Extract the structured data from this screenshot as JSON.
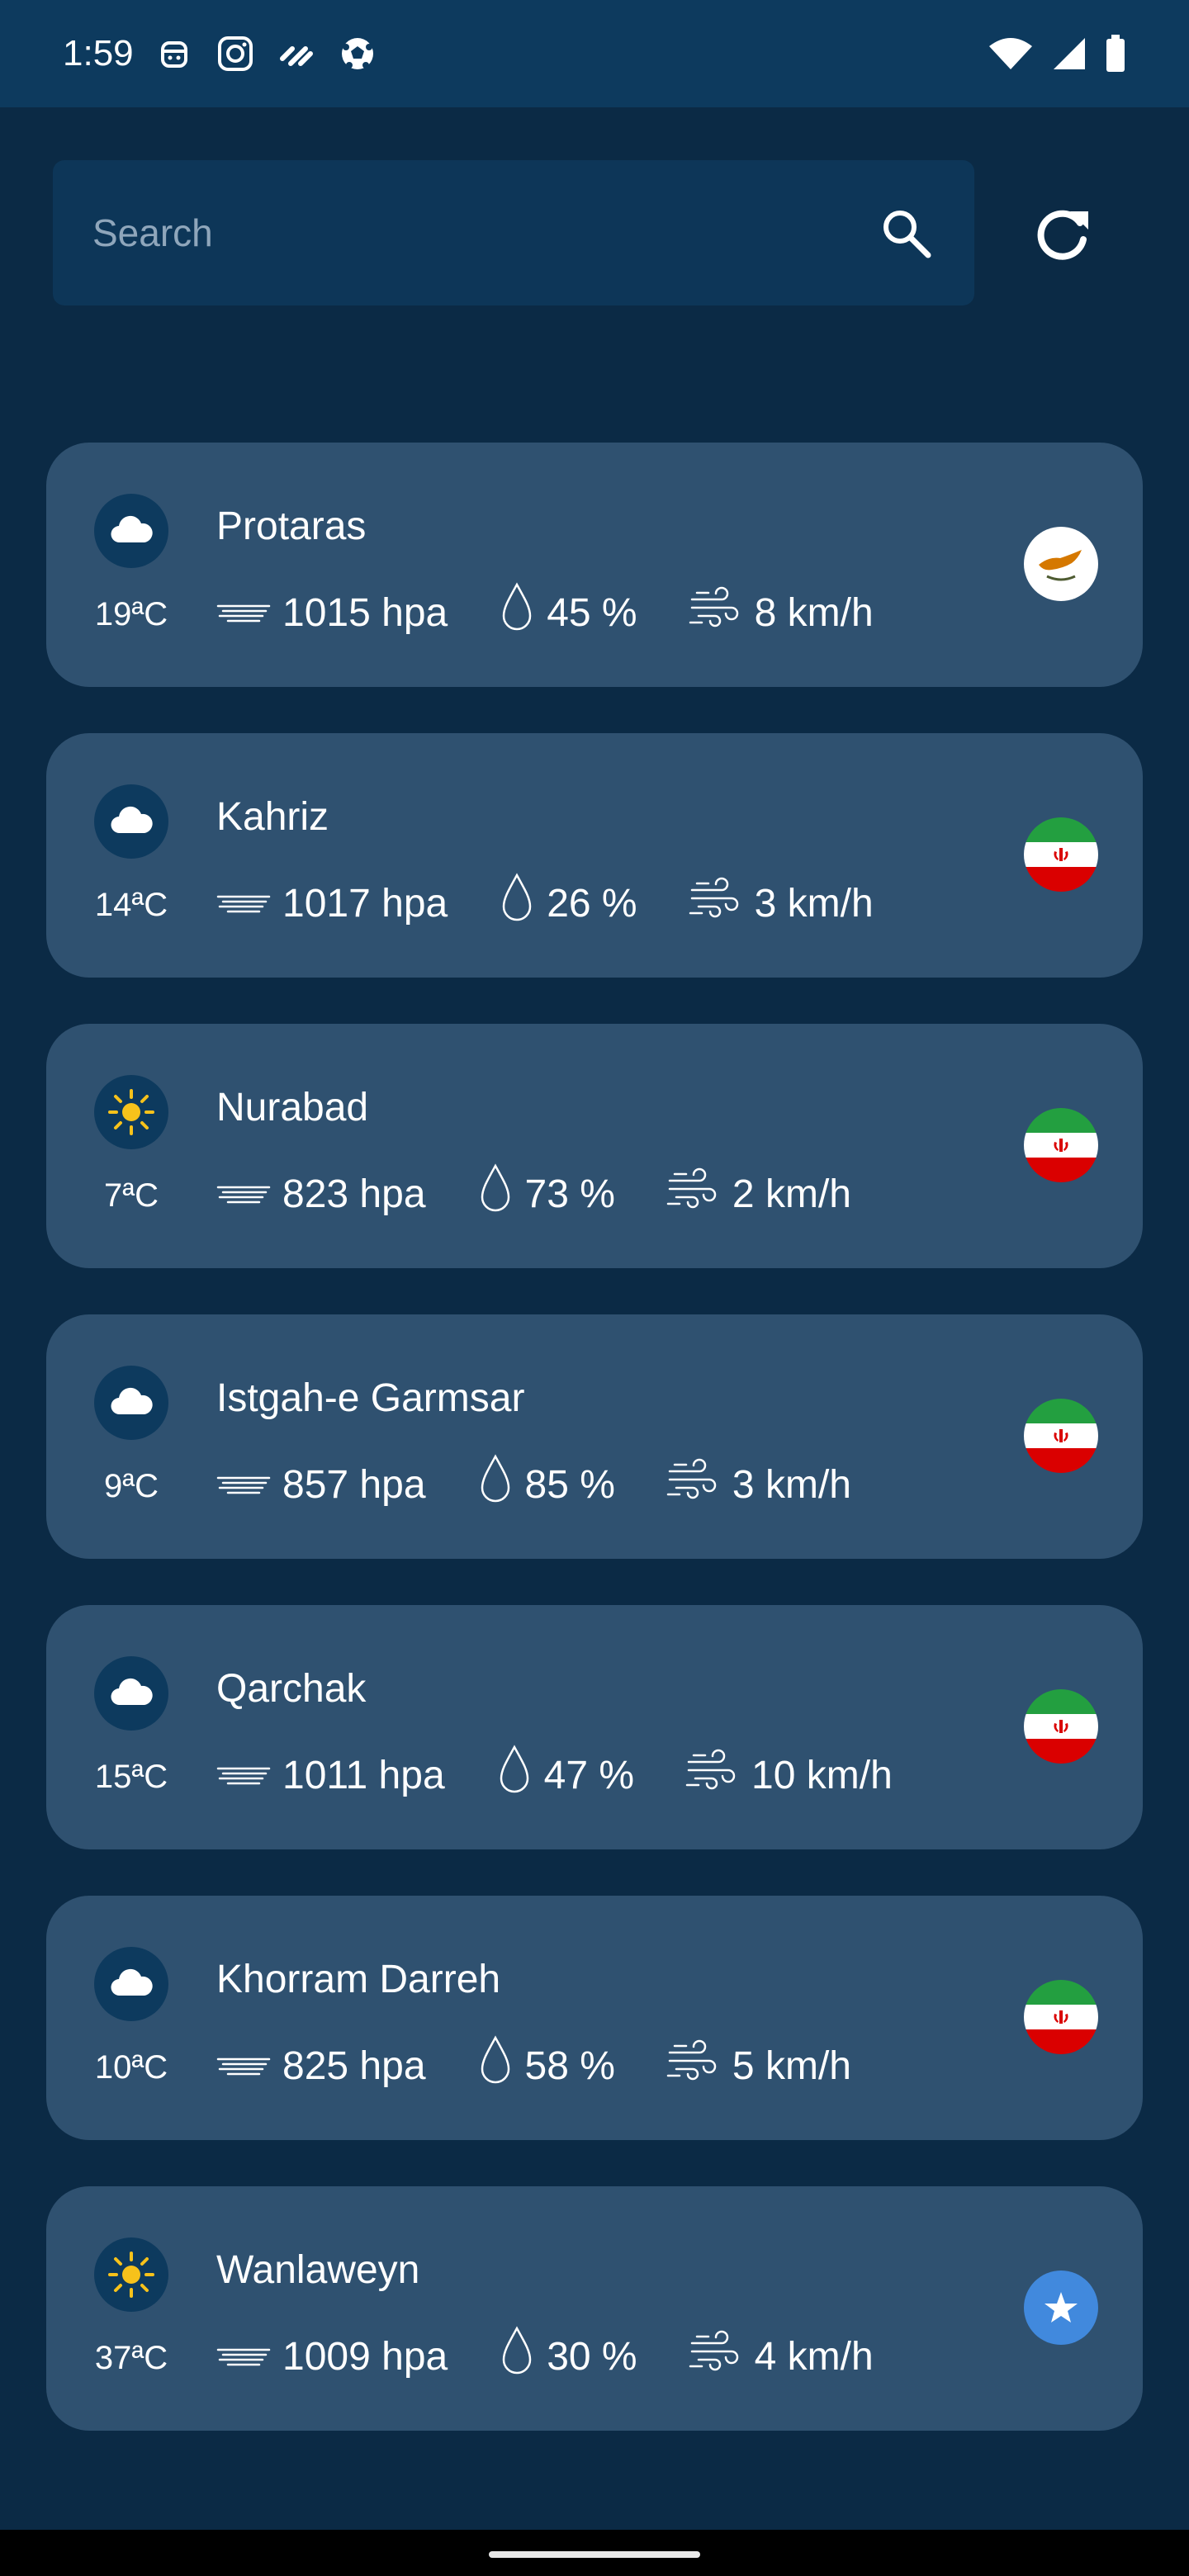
{
  "status_bar": {
    "time": "1:59",
    "notification_icons": [
      "app-icon",
      "instagram-icon",
      "tidal-icon",
      "soccer-ball-icon"
    ],
    "system_icons": [
      "wifi-icon",
      "signal-icon",
      "battery-icon"
    ]
  },
  "search": {
    "placeholder": "Search",
    "value": ""
  },
  "colors": {
    "background": "#0b2a45",
    "card": "#2f5170",
    "status_bar": "#0d3a5e",
    "search_box": "#0d3658",
    "sun": "#f7c21b"
  },
  "cities": [
    {
      "name": "Protaras",
      "temp": "19ªC",
      "pressure": "1015 hpa",
      "humidity": "45 %",
      "wind": "8 km/h",
      "weather": "cloud-icon",
      "flag": "cyprus-flag-icon"
    },
    {
      "name": "Kahriz",
      "temp": "14ªC",
      "pressure": "1017 hpa",
      "humidity": "26 %",
      "wind": "3 km/h",
      "weather": "cloud-icon",
      "flag": "iran-flag-icon"
    },
    {
      "name": "Nurabad",
      "temp": "7ªC",
      "pressure": "823 hpa",
      "humidity": "73 %",
      "wind": "2 km/h",
      "weather": "sun-icon",
      "flag": "iran-flag-icon"
    },
    {
      "name": "Istgah-e Garmsar",
      "temp": "9ªC",
      "pressure": "857 hpa",
      "humidity": "85 %",
      "wind": "3 km/h",
      "weather": "cloud-icon",
      "flag": "iran-flag-icon"
    },
    {
      "name": "Qarchak",
      "temp": "15ªC",
      "pressure": "1011 hpa",
      "humidity": "47 %",
      "wind": "10 km/h",
      "weather": "cloud-icon",
      "flag": "iran-flag-icon"
    },
    {
      "name": "Khorram Darreh",
      "temp": "10ªC",
      "pressure": "825 hpa",
      "humidity": "58 %",
      "wind": "5 km/h",
      "weather": "cloud-icon",
      "flag": "iran-flag-icon"
    },
    {
      "name": "Wanlaweyn",
      "temp": "37ªC",
      "pressure": "1009 hpa",
      "humidity": "30 %",
      "wind": "4 km/h",
      "weather": "sun-icon",
      "flag": "somalia-flag-icon"
    }
  ]
}
